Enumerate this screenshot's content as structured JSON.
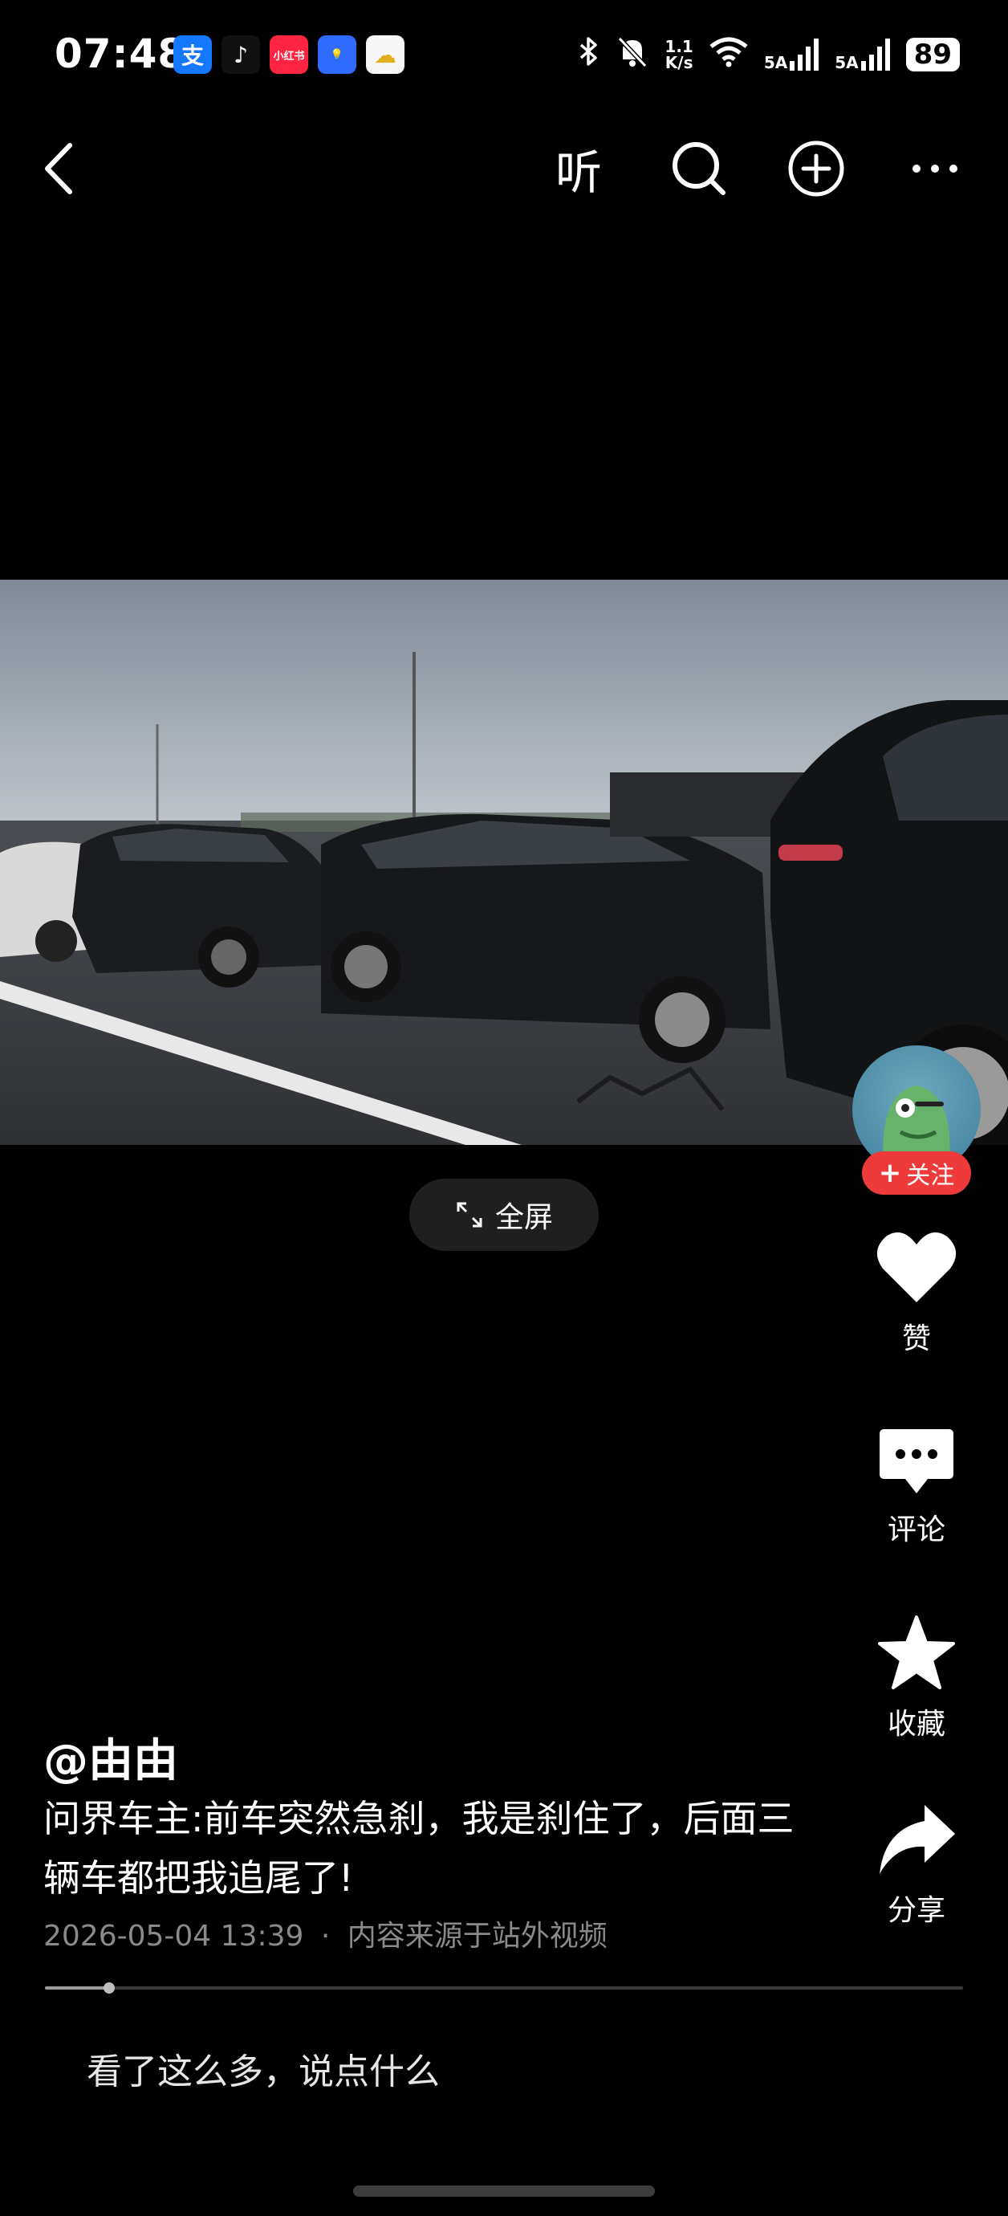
{
  "status_bar": {
    "time": "07:48",
    "app_icons": [
      {
        "name": "alipay-icon",
        "glyph": "支",
        "color": "#1677ff"
      },
      {
        "name": "douyin-icon",
        "glyph": "♪",
        "color": "#111111"
      },
      {
        "name": "xiaohongshu-icon",
        "glyph": "小红书",
        "color": "#ff2442"
      },
      {
        "name": "bulb-app-icon",
        "glyph": "💡",
        "color": "#2f6bff"
      },
      {
        "name": "cloud-app-icon",
        "glyph": "☁",
        "color": "#f7f7f7"
      }
    ],
    "network_speed": "1.1\nK/s",
    "signal_1": "5A",
    "signal_2": "5A",
    "battery": "89"
  },
  "nav": {
    "listen_label": "听"
  },
  "video": {
    "fullscreen_label": "全屏"
  },
  "rail": {
    "follow_label": "关注",
    "like_label": "赞",
    "comment_label": "评论",
    "favorite_label": "收藏",
    "share_label": "分享"
  },
  "post": {
    "author": "@由由",
    "caption": "问界车主:前车突然急刹，我是刹住了，后面三辆车都把我追尾了!",
    "timestamp": "2026-05-04 13:39",
    "source": "内容来源于站外视频",
    "separator": "·",
    "progress": 0.07
  },
  "comment_box": {
    "placeholder": "看了这么多，说点什么"
  }
}
